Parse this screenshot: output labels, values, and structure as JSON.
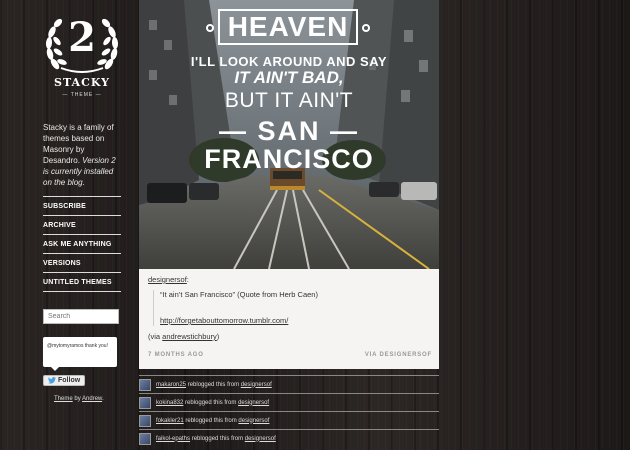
{
  "sidebar": {
    "logo_number": "2",
    "logo_name": "STACKY",
    "logo_sub": "— THEME —",
    "description_plain": "Stacky is a family of themes based on Masonry by Desandro.",
    "description_em": "Version 2 is currently installed on the blog.",
    "nav": [
      "SUBSCRIBE",
      "ARCHIVE",
      "ASK ME ANYTHING",
      "VERSIONS",
      "UNTITLED THEMES"
    ],
    "search_placeholder": "Search",
    "tweet_text": "@mytomyramos thank you!",
    "follow_label": "Follow",
    "credits_theme": "Theme",
    "credits_by": "by",
    "credits_author": "Andrew"
  },
  "post": {
    "image_text": {
      "heaven": "HEAVEN",
      "line1": "I'LL LOOK AROUND AND SAY",
      "line2": "IT AIN'T BAD,",
      "line3": "BUT IT AIN'T",
      "line4": "— SAN —",
      "line5": "FRANCISCO"
    },
    "author": "designersof",
    "author_suffix": ":",
    "quote_text": "“It ain’t San Francisco” (Quote from Herb Caen)",
    "quote_link": "http://forgetabouttomorrow.tumblr.com/",
    "via_prefix": "(via ",
    "via_user": "andrewstichbury",
    "via_suffix": ")",
    "time": "7 MONTHS AGO",
    "via_label": "VIA DESIGNERSOF"
  },
  "notes": [
    {
      "user": "makaron25",
      "action": "reblogged this from",
      "source": "designersof"
    },
    {
      "user": "kokina832",
      "action": "reblogged this from",
      "source": "designersof"
    },
    {
      "user": "fokakler21",
      "action": "reblogged this from",
      "source": "designersof"
    },
    {
      "user": "faikol-epaths",
      "action": "reblogged this from",
      "source": "designersof"
    }
  ],
  "colors": {
    "background": "#231f1d",
    "post_background": "#f5f4f2",
    "accent_text": "#ffffff"
  }
}
